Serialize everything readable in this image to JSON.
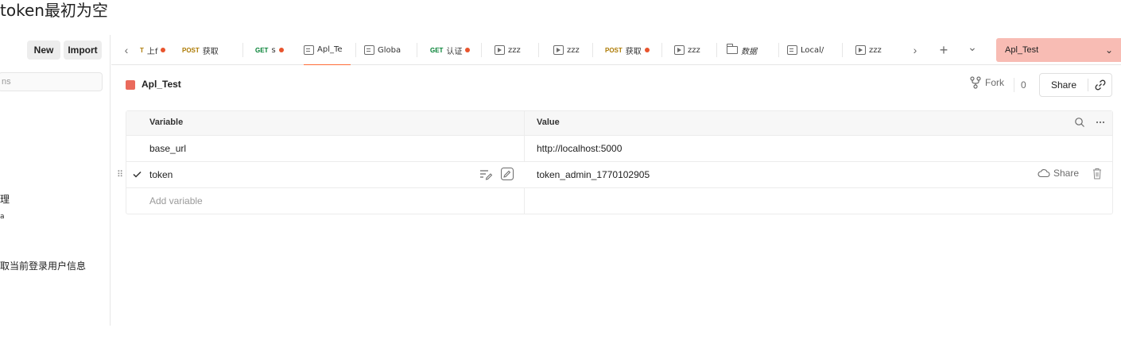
{
  "caption": "token最初为空",
  "sidebar": {
    "new_label": "New",
    "import_label": "Import",
    "search_placeholder": "ns",
    "items": [
      "理",
      "a",
      "取当前登录用户信息"
    ]
  },
  "tabs": [
    {
      "method": "T",
      "label": "上f",
      "dot": true
    },
    {
      "method": "POST",
      "label": "获取",
      "dot": false
    },
    {
      "method": "GET",
      "label": "s",
      "dot": true
    },
    {
      "method": "",
      "label": "Apl_Te",
      "dot": false,
      "icon": "environment-icon",
      "active": true
    },
    {
      "method": "",
      "label": "Globa",
      "dot": false,
      "icon": "environment-icon"
    },
    {
      "method": "GET",
      "label": "认证",
      "dot": true
    },
    {
      "method": "",
      "label": "zzz",
      "dot": false,
      "icon": "flow-icon"
    },
    {
      "method": "",
      "label": "zzz",
      "dot": false,
      "icon": "flow-icon"
    },
    {
      "method": "POST",
      "label": "获取",
      "dot": true
    },
    {
      "method": "",
      "label": "zzz",
      "dot": false,
      "icon": "flow-icon"
    },
    {
      "method": "",
      "label": "数据",
      "dot": false,
      "icon": "folder-icon"
    },
    {
      "method": "",
      "label": "Local/",
      "dot": false,
      "icon": "environment-icon"
    },
    {
      "method": "",
      "label": "zzz",
      "dot": false,
      "icon": "flow-icon"
    }
  ],
  "tabbar": {
    "prev": "‹",
    "next": "›",
    "add": "+",
    "more": "⌄"
  },
  "environment_selector": {
    "value": "Apl_Test",
    "chevron": "⌄"
  },
  "collection": {
    "title": "Apl_Test",
    "color": "#ea6a5c",
    "fork_label": "Fork",
    "fork_count": "0",
    "share_label": "Share"
  },
  "variables_table": {
    "headers": {
      "variable": "Variable",
      "value": "Value"
    },
    "rows": [
      {
        "variable": "base_url",
        "value": "http://localhost:5000",
        "checked": false
      },
      {
        "variable": "token",
        "value": "token_admin_1770102905",
        "checked": true,
        "share_label": "Share"
      }
    ],
    "add_placeholder": "Add variable"
  },
  "colors": {
    "accent": "#ff6c37",
    "env_bg": "#f8bcb4",
    "post": "#ad7a03",
    "get": "#007f31"
  }
}
